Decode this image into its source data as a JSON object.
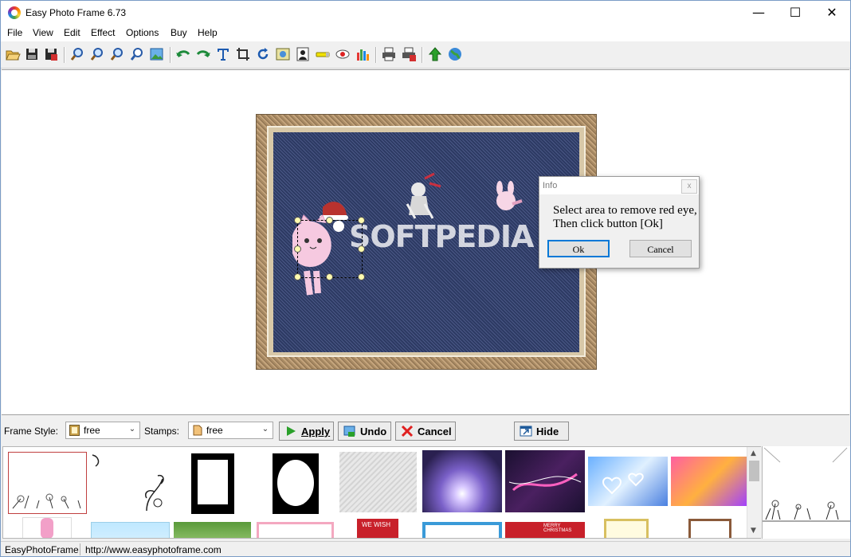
{
  "window": {
    "title": "Easy Photo Frame 6.73",
    "minimize": "—",
    "maximize": "☐",
    "close": "✕"
  },
  "menu": [
    "File",
    "View",
    "Edit",
    "Effect",
    "Options",
    "Buy",
    "Help"
  ],
  "toolbar_icons": [
    "open-folder-icon",
    "save-icon",
    "save-as-icon",
    "zoom-in-icon",
    "zoom-out-icon",
    "zoom-fit-icon",
    "zoom-actual-icon",
    "insert-image-icon",
    "undo-icon",
    "redo-icon",
    "add-text-icon",
    "crop-icon",
    "rotate-icon",
    "adjust-icon",
    "portrait-icon",
    "brush-icon",
    "red-eye-icon",
    "histogram-icon",
    "print-icon",
    "print-setup-icon",
    "update-icon",
    "website-icon"
  ],
  "canvas": {
    "watermark": "SOFTPEDIA"
  },
  "dialog": {
    "title": "Info",
    "close": "x",
    "message_line1": "Select area to remove red eye,",
    "message_line2": "Then click button [Ok]",
    "ok": "Ok",
    "cancel": "Cancel"
  },
  "controls": {
    "frame_style_label": "Frame Style:",
    "frame_style_value": "free",
    "stamps_label": "Stamps:",
    "stamps_value": "free",
    "apply": "Apply",
    "undo": "Undo",
    "cancel": "Cancel",
    "hide": "Hide"
  },
  "gallery": {
    "row2_labels": [
      "WE WISH",
      "MERRY CHRISTMAS"
    ]
  },
  "status": {
    "app_name": "EasyPhotoFrame",
    "url": "http://www.easyphotoframe.com"
  },
  "colors": {
    "photo_background": "#34416e",
    "frame_wood": "#a88a63",
    "apply_icon": "#2aa02a",
    "cancel_icon": "#e02020"
  }
}
